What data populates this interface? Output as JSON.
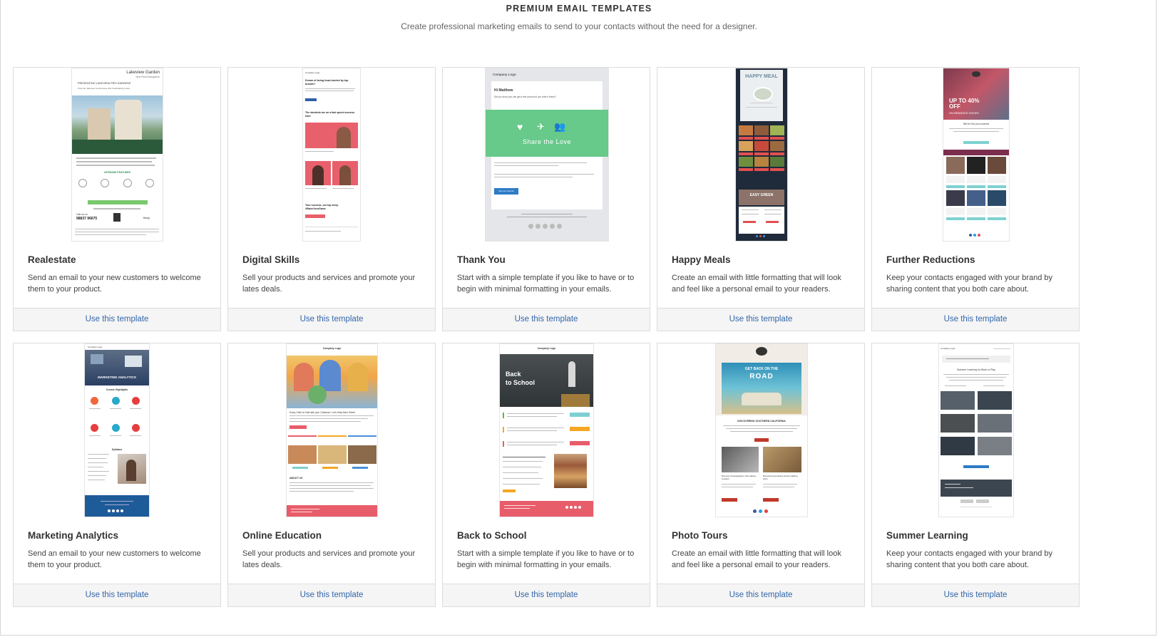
{
  "header": {
    "title": "PREMIUM EMAIL TEMPLATES",
    "subtitle": "Create professional marketing emails to send to your contacts without the need for a designer."
  },
  "cards": [
    {
      "title": "Realestate",
      "description": "Send an email to your new customers to welcome them to your product.",
      "action": "Use this template",
      "thumb_text": [
        "Lakeview Garden",
        "New Finds Bangalore",
        "PRESENTING LAKEVIEW PRO GARDENS",
        "Premium lakeview townhouses with breathtaking views",
        "UPGRADE FEATURES",
        "Call us on",
        "98837 96675",
        "Bangi"
      ]
    },
    {
      "title": "Digital Skills",
      "description": "Sell your products and services and promote your lates deals.",
      "action": "Use this template",
      "thumb_text": [
        "Company Logo",
        "Dream of being head-hunted by top brands?",
        "Learn More",
        "The students are on a fast speed success train",
        "Your success, our top story.",
        "#RaiseYourGame",
        "Start Learning Today"
      ]
    },
    {
      "title": "Thank You",
      "description": "Start with a simple template if you like to have or to begin with minimal formatting in your emails.",
      "action": "Use this template",
      "thumb_text": [
        "Company Logo",
        "Hi Matthew",
        "Did you know you can get a free account if you refer a friend?",
        "Share the Love",
        "Tell your friends!"
      ]
    },
    {
      "title": "Happy Meals",
      "description": "Create an email with little formatting that will look and feel like a personal email to your readers.",
      "action": "Use this template",
      "thumb_text": [
        "HAPPY MEAL",
        "EASY GREEN"
      ]
    },
    {
      "title": "Further Reductions",
      "description": "Keep your contacts engaged with your brand by sharing content that you both care about.",
      "action": "Use this template",
      "thumb_text": [
        "UP TO 40% OFF",
        "ON BRANDED SHOES",
        "We've Got you covered"
      ]
    },
    {
      "title": "Marketing Analytics",
      "description": "Send an email to your new customers to welcome them to your product.",
      "action": "Use this template",
      "thumb_text": [
        "Company Logo",
        "MARKETING ANALYTICS",
        "Course Highlights",
        "Syllabus"
      ]
    },
    {
      "title": "Online Education",
      "description": "Sell your products and services and promote your lates deals.",
      "action": "Use this template",
      "thumb_text": [
        "Company Logo",
        "Every Child Is Gold with your Guidance. Let's Help them Shine!",
        "ABOUT US"
      ]
    },
    {
      "title": "Back to School",
      "description": "Start with a simple template if you like to have or to begin with minimal formatting in your emails.",
      "action": "Use this template",
      "thumb_text": [
        "Company Logo",
        "Back",
        "to School"
      ]
    },
    {
      "title": "Photo Tours",
      "description": "Create an email with little formatting that will look and feel like a personal email to your readers.",
      "action": "Use this template",
      "thumb_text": [
        "GET BACK ON THE",
        "ROAD",
        "DISCOVERING SOUTHERN CALIFORNIA",
        "Discover photographers, filmmakers, creators",
        "Discovering amazing Venice walking tours"
      ]
    },
    {
      "title": "Summer Learning",
      "description": "Keep your contacts engaged with your brand by sharing content that you both care about.",
      "action": "Use this template",
      "thumb_text": [
        "Company Logo",
        "Summer Learning for Work or Play"
      ]
    }
  ],
  "colors": {
    "link": "#3366aa",
    "footer_bg": "#f5f5f5",
    "border": "#dcdcdc"
  }
}
